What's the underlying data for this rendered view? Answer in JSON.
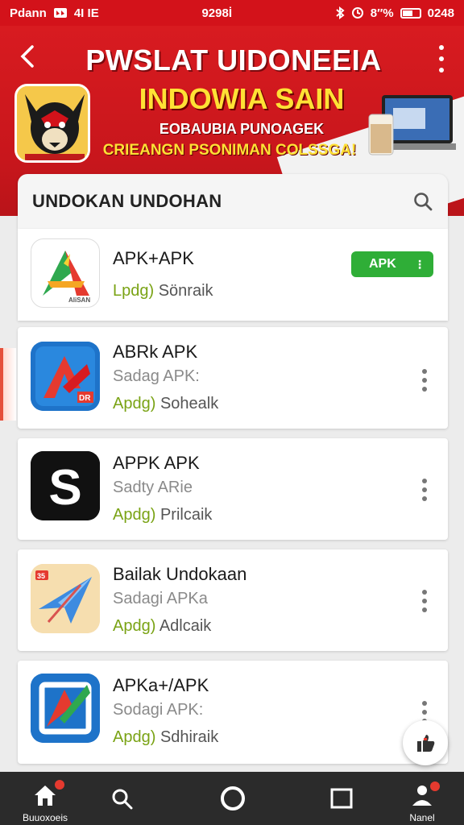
{
  "status_bar": {
    "carrier": "Pdann",
    "left_extra": "4I IE",
    "time": "9298İ",
    "battery": "8″%",
    "right_time": "0248"
  },
  "banner": {
    "title": "PWSLAT UIDONEEIA",
    "subtitle": "INDOWIA SAIN",
    "line1": "EOBAUBIA PUNOAGEK",
    "line2": "CRIEANGN PSONIMAN COLSSGA!",
    "accent_red": "#d3121a",
    "accent_yellow": "#ffe135"
  },
  "search": {
    "label": "UNDOKAN UNDOHAN",
    "icon": "search-icon"
  },
  "apps": [
    {
      "name": "APK+APK",
      "sub": "",
      "tag": "Lpdg)",
      "meta": "Sönraik",
      "action": "APK",
      "icon": "tricolor-a-icon"
    },
    {
      "name": "ABRk APK",
      "sub": "Sadag APK:",
      "tag": "Apdg)",
      "meta": "Sohealk",
      "icon": "red-blue-a-icon"
    },
    {
      "name": "APPK APK",
      "sub": "Sadty ARie",
      "tag": "Apdg)",
      "meta": "Prilcaik",
      "icon": "black-s-icon"
    },
    {
      "name": "Bailak Undokaan",
      "sub": "Sadagi APKa",
      "tag": "Apdg)",
      "meta": "Adlcaik",
      "icon": "paper-plane-icon"
    },
    {
      "name": "APKa+/APK",
      "sub": "Sodagi APK:",
      "tag": "Apdg)",
      "meta": "Sdhiraik",
      "icon": "blue-square-a-icon"
    }
  ],
  "bottom_nav": {
    "home_label": "Buuoxoeis",
    "profile_label": "Nanel"
  }
}
